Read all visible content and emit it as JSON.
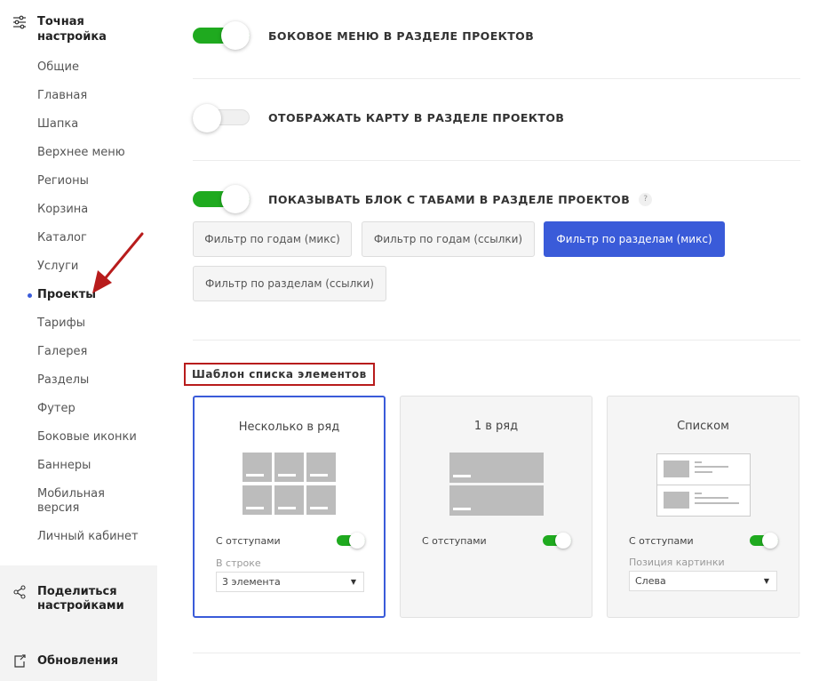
{
  "sidebar": {
    "title": "Точная настройка",
    "items": [
      {
        "label": "Общие"
      },
      {
        "label": "Главная"
      },
      {
        "label": "Шапка"
      },
      {
        "label": "Верхнее меню"
      },
      {
        "label": "Регионы"
      },
      {
        "label": "Корзина"
      },
      {
        "label": "Каталог"
      },
      {
        "label": "Услуги"
      },
      {
        "label": "Проекты",
        "active": true
      },
      {
        "label": "Тарифы"
      },
      {
        "label": "Галерея"
      },
      {
        "label": "Разделы"
      },
      {
        "label": "Футер"
      },
      {
        "label": "Боковые иконки"
      },
      {
        "label": "Баннеры"
      },
      {
        "label": "Мобильная версия"
      },
      {
        "label": "Личный кабинет"
      }
    ],
    "share_label": "Поделиться настройками",
    "updates_label": "Обновления"
  },
  "settings": {
    "side_menu": {
      "label": "Боковое меню в разделе проектов",
      "on": true
    },
    "show_map": {
      "label": "Отображать карту в разделе проектов",
      "on": false
    },
    "tabs_block": {
      "label": "Показывать блок с табами в разделе проектов",
      "on": true,
      "help": "?"
    }
  },
  "filters": [
    {
      "label": "Фильтр по годам (микс)"
    },
    {
      "label": "Фильтр по годам (ссылки)"
    },
    {
      "label": "Фильтр по разделам (микс)",
      "active": true
    },
    {
      "label": "Фильтр по разделам (ссылки)"
    }
  ],
  "template_section": {
    "title": "Шаблон списка элементов",
    "cards": [
      {
        "title": "Несколько в ряд",
        "option": "С отступами",
        "option_on": true,
        "sublabel": "В строке",
        "select_value": "3 элемента",
        "selected": true
      },
      {
        "title": "1 в ряд",
        "option": "С отступами",
        "option_on": true
      },
      {
        "title": "Списком",
        "option": "С отступами",
        "option_on": true,
        "sublabel": "Позиция картинки",
        "select_value": "Слева"
      }
    ]
  },
  "colors": {
    "accent": "#3a5bd9",
    "toggle_on": "#1faa1f",
    "highlight": "#b81c1c"
  }
}
